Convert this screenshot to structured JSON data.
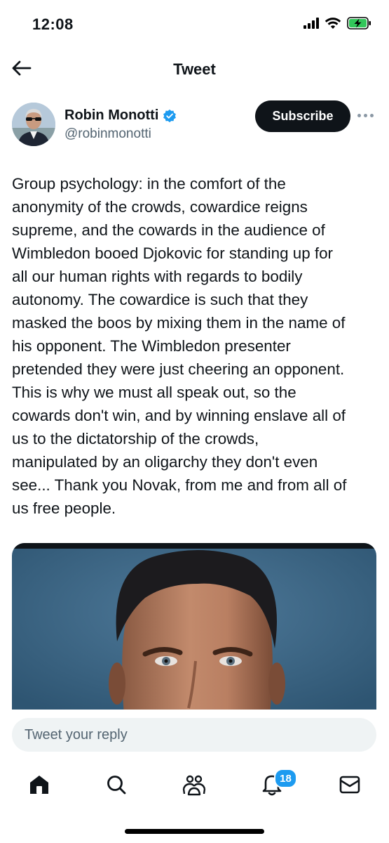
{
  "status_bar": {
    "time": "12:08"
  },
  "header": {
    "title": "Tweet",
    "back_icon": "arrow-left-icon"
  },
  "author": {
    "name": "Robin Monotti",
    "handle": "@robinmonotti",
    "verified": true,
    "subscribe_label": "Subscribe"
  },
  "tweet": {
    "text": "Group psychology: in the comfort of the\nanonymity of the crowds, cowardice reigns\nsupreme, and the cowards in the audience of\nWimbledon booed Djokovic for standing up for\nall our human rights with regards to bodily\nautonomy. The cowardice is such that they\nmasked the boos by mixing them in the name of\nhis opponent. The Wimbledon presenter\npretended they were just cheering an opponent.\nThis is why we must all speak out, so the\ncowards don't win, and by winning enslave all of\nus to the dictatorship of the crowds,\nmanipulated by an oligarchy they don't even\nsee... Thank you Novak, from me and from all of\nus free people."
  },
  "reply": {
    "placeholder": "Tweet your reply"
  },
  "bottom_nav": {
    "items": [
      "home-icon",
      "search-icon",
      "communities-icon",
      "notifications-icon",
      "messages-icon"
    ],
    "notifications_badge": "18"
  },
  "colors": {
    "accent": "#1d9bf0",
    "text": "#0f1419",
    "secondary": "#536471",
    "reply_bg": "#eff3f4"
  }
}
